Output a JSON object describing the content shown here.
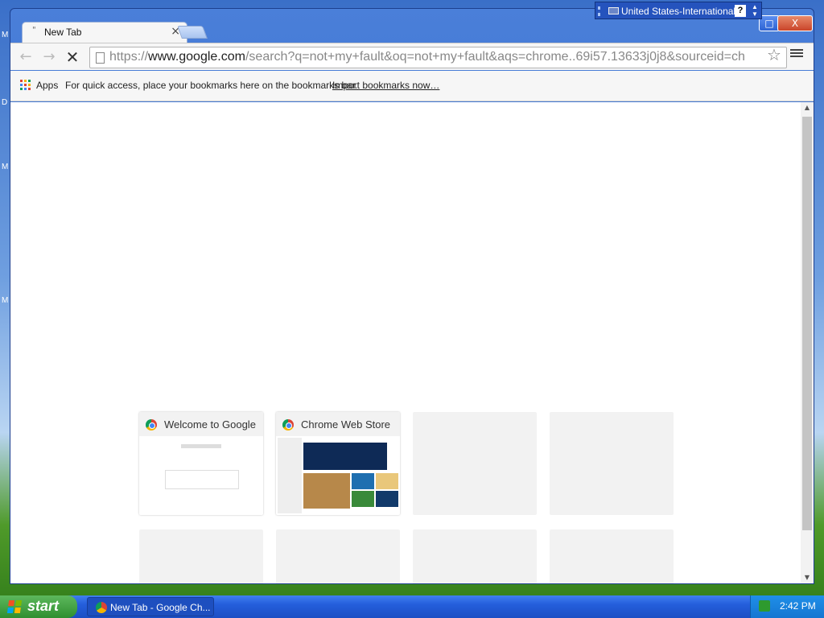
{
  "desktop": {
    "letters": [
      "M",
      "D",
      "M",
      "M"
    ]
  },
  "window": {
    "tab": {
      "title": "New Tab",
      "close_label": "×"
    },
    "controls": {
      "minimize": "_",
      "maximize": "□",
      "close": "X"
    }
  },
  "language_bar": {
    "label": "United States-International",
    "help": "?"
  },
  "toolbar": {
    "back": "←",
    "forward": "→",
    "stop": "✕",
    "url_prefix": "https://",
    "url_host": "www.google.com",
    "url_rest": "/search?q=not+my+fault&oq=not+my+fault&aqs=chrome..69i57.13633j0j8&sourceid=ch",
    "star": "☆"
  },
  "bookmarks_bar": {
    "apps_label": "Apps",
    "hint": "For quick access, place your bookmarks here on the bookmarks bar.",
    "import_link": "Import bookmarks now…"
  },
  "most_visited": [
    {
      "title": "Welcome to Google Chrome",
      "filled": true
    },
    {
      "title": "Chrome Web Store",
      "filled": true
    },
    {
      "title": "",
      "filled": false
    },
    {
      "title": "",
      "filled": false
    },
    {
      "title": "",
      "filled": false
    },
    {
      "title": "",
      "filled": false
    },
    {
      "title": "",
      "filled": false
    },
    {
      "title": "",
      "filled": false
    }
  ],
  "taskbar": {
    "start_label": "start",
    "task_label": "New Tab - Google Ch...",
    "clock": "2:42 PM"
  }
}
